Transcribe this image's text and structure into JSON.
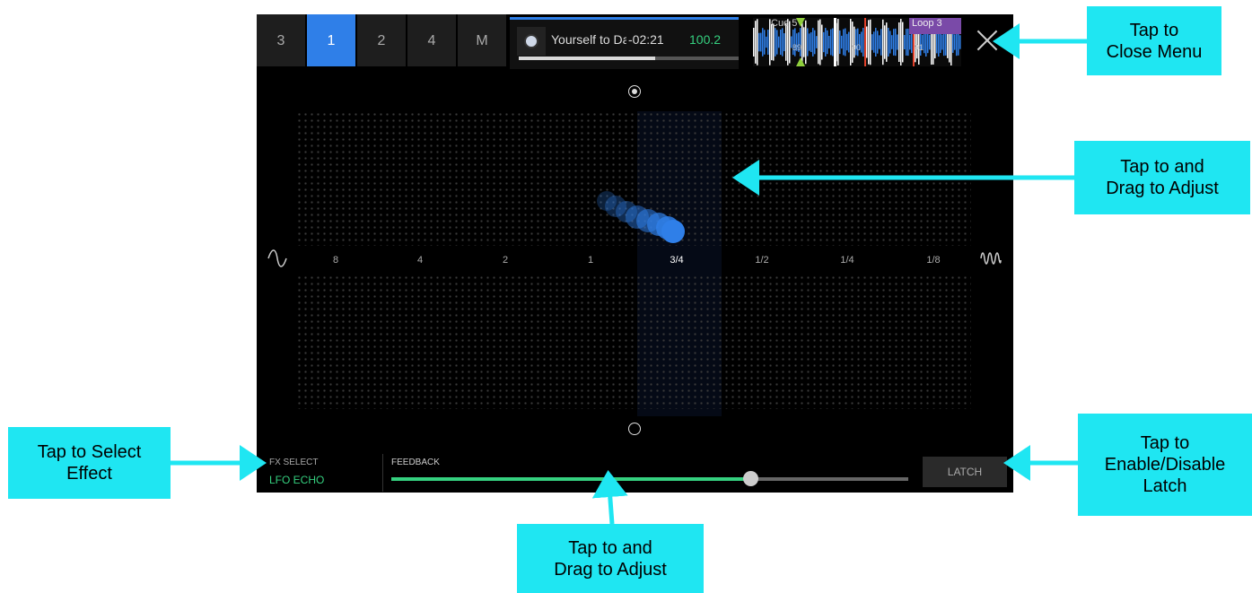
{
  "tabs": [
    {
      "label": "3",
      "active": false
    },
    {
      "label": "1",
      "active": true
    },
    {
      "label": "2",
      "active": false
    },
    {
      "label": "4",
      "active": false
    },
    {
      "label": "M",
      "active": false
    }
  ],
  "deck": {
    "title": "Yourself to Dance",
    "time": "-02:21",
    "bpm": "100.2",
    "progress": 0.62
  },
  "waveform": {
    "cue": "Cue 5",
    "loop": "Loop 3",
    "bars": [
      "89",
      "90",
      "91"
    ]
  },
  "fx_grid": {
    "divisions": [
      "8",
      "4",
      "2",
      "1",
      "3/4",
      "1/2",
      "1/4",
      "1/8"
    ],
    "selected": "3/4"
  },
  "fx_select": {
    "label": "FX SELECT",
    "value": "LFO ECHO"
  },
  "feedback": {
    "label": "FEEDBACK",
    "value": 0.695
  },
  "latch": {
    "label": "LATCH"
  },
  "callouts": {
    "close": "Tap to\nClose Menu",
    "grid": "Tap to and\nDrag to Adjust",
    "fx": "Tap to Select\nEffect",
    "latch": "Tap to\nEnable/Disable\nLatch",
    "feedback": "Tap to and\nDrag to Adjust"
  },
  "colors": {
    "accent": "#2f7fe8",
    "green": "#35d07f",
    "callout": "#1fe6f2"
  }
}
